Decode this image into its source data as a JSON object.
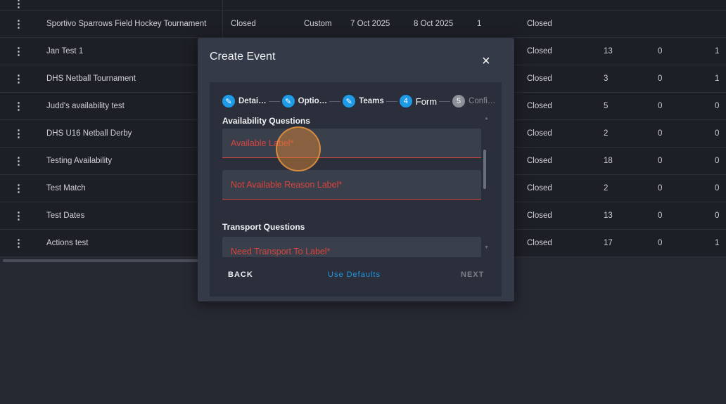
{
  "rows": [
    {
      "name": "",
      "cols": []
    },
    {
      "name": "Sportivo Sparrows Field Hockey Tournament",
      "status": "Closed",
      "type": "Custom",
      "start": "7 Oct 2025",
      "end": "8 Oct 2025",
      "count": "1",
      "state": "Closed",
      "a": "",
      "b": "",
      "c": ""
    },
    {
      "name": "Jan Test 1",
      "state": "Closed",
      "a": "13",
      "b": "0",
      "c": "1"
    },
    {
      "name": "DHS Netball Tournament",
      "state": "Closed",
      "a": "3",
      "b": "0",
      "c": "1"
    },
    {
      "name": "Judd's availability test",
      "state": "Closed",
      "a": "5",
      "b": "0",
      "c": "0"
    },
    {
      "name": "DHS U16 Netball Derby",
      "state": "Closed",
      "a": "2",
      "b": "0",
      "c": "0"
    },
    {
      "name": "Testing Availability",
      "state": "Closed",
      "a": "18",
      "b": "0",
      "c": "0"
    },
    {
      "name": "Test Match",
      "state": "Closed",
      "a": "2",
      "b": "0",
      "c": "0"
    },
    {
      "name": "Test Dates",
      "state": "Closed",
      "a": "13",
      "b": "0",
      "c": "0"
    },
    {
      "name": "Actions test",
      "state": "Closed",
      "a": "17",
      "b": "0",
      "c": "1"
    }
  ],
  "modal": {
    "title": "Create Event",
    "close_icon": "×",
    "steps": [
      {
        "num": "✎",
        "label": "Detai…",
        "state": "done"
      },
      {
        "num": "✎",
        "label": "Optio…",
        "state": "done"
      },
      {
        "num": "✎",
        "label": "Teams",
        "state": "done"
      },
      {
        "num": "4",
        "label": "Form",
        "state": "active"
      },
      {
        "num": "5",
        "label": "Confi…",
        "state": "pending"
      }
    ],
    "availability_title": "Availability Questions",
    "available_label": "Available Label*",
    "not_available_label": "Not Available Reason Label*",
    "transport_title": "Transport Questions",
    "need_transport_label": "Need Transport To Label*",
    "back": "BACK",
    "use_defaults": "Use Defaults",
    "next": "NEXT"
  },
  "colors": {
    "accent": "#1e9be6",
    "error": "#d9443f"
  }
}
